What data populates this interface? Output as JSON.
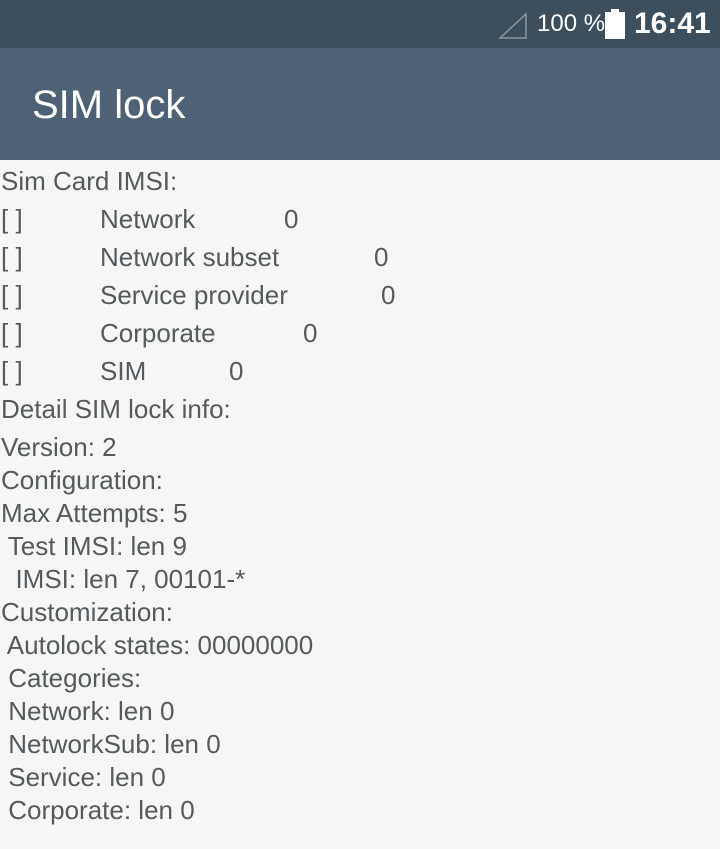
{
  "status_bar": {
    "battery_percent": "100 %",
    "time": "16:41"
  },
  "app_bar": {
    "title": "SIM lock"
  },
  "content": {
    "sim_card_imsi_label": "Sim Card IMSI:",
    "lock_rows": [
      {
        "checkbox": "[ ]",
        "name": "Network",
        "value": "0"
      },
      {
        "checkbox": "[ ]",
        "name": "Network subset",
        "value": "0"
      },
      {
        "checkbox": "[ ]",
        "name": "Service provider",
        "value": "0"
      },
      {
        "checkbox": "[ ]",
        "name": "Corporate",
        "value": "0"
      },
      {
        "checkbox": "[ ]",
        "name": "SIM",
        "value": "0"
      }
    ],
    "detail_label": "Detail SIM lock info:",
    "details": [
      "Version: 2",
      "Configuration:",
      "Max Attempts: 5",
      " Test IMSI: len 9",
      "  IMSI: len 7, 00101-*",
      "Customization:",
      " Autolock states: 00000000",
      " Categories:",
      " Network: len 0",
      " NetworkSub: len 0",
      " Service: len 0",
      " Corporate: len 0"
    ]
  }
}
